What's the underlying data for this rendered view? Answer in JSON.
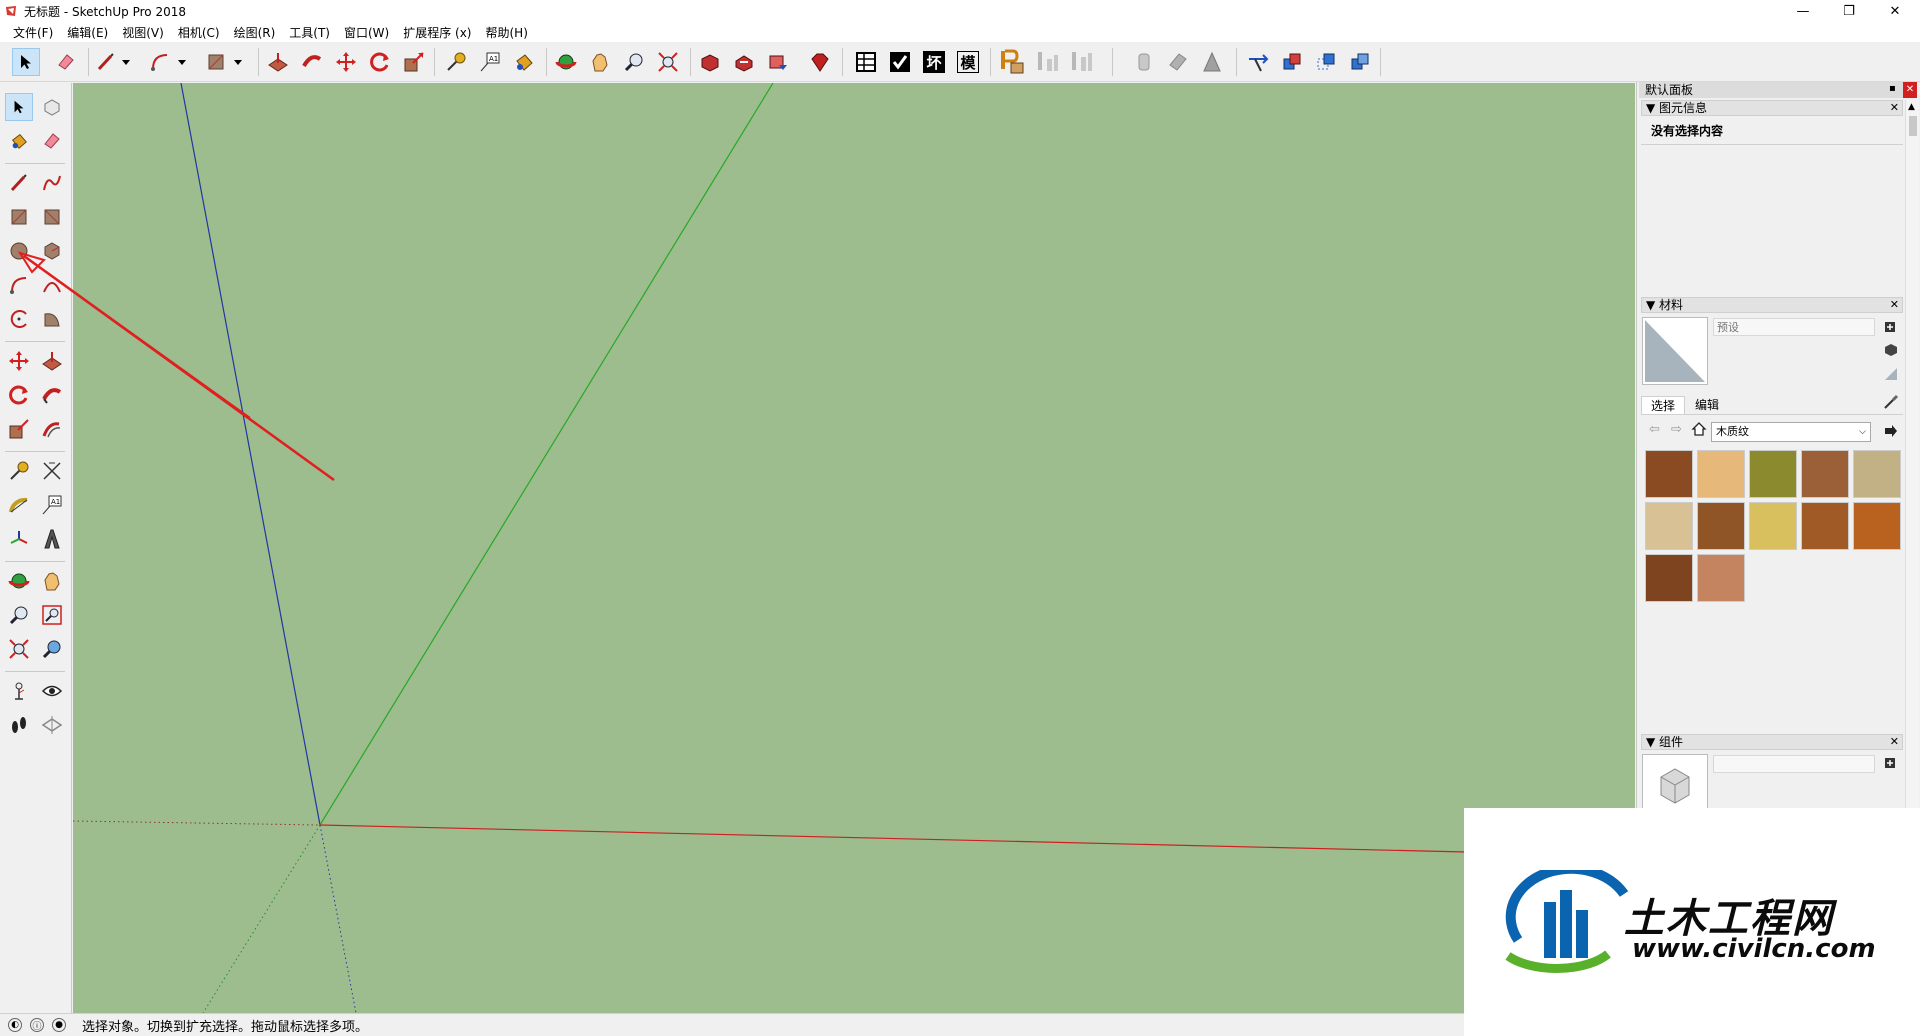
{
  "window": {
    "title": "无标题 - SketchUp Pro 2018",
    "controls": {
      "minimize": "—",
      "restore": "❐",
      "close": "✕"
    }
  },
  "menu": [
    "文件(F)",
    "编辑(E)",
    "视图(V)",
    "相机(C)",
    "绘图(R)",
    "工具(T)",
    "窗口(W)",
    "扩展程序 (x)",
    "帮助(H)"
  ],
  "toolbar": {
    "text_buttons": [
      "坏",
      "模"
    ]
  },
  "tray": {
    "title": "默认面板",
    "entity_info": {
      "header": "▼ 图元信息",
      "content": "没有选择内容"
    },
    "materials": {
      "header": "▼ 材料",
      "name_placeholder": "预设",
      "tabs": [
        "选择",
        "编辑"
      ],
      "library": "木质纹",
      "swatches": [
        "#8a4a22",
        "#e6b97a",
        "#8c8a2e",
        "#9b6038",
        "#c2b185",
        "#d9c196",
        "#8f5527",
        "#d8c05f",
        "#a05a26",
        "#b9621f",
        "#7e4420",
        "#c48460"
      ]
    },
    "components": {
      "header": "▼ 组件"
    }
  },
  "status": {
    "text": "选择对象。切换到扩充选择。拖动鼠标选择多项。"
  },
  "watermark": {
    "name": "土木工程网",
    "url": "www.civilcn.com"
  },
  "colors": {
    "viewport": "#9dbd8e",
    "axis_red": "#cc1f1f",
    "axis_green": "#27a827",
    "axis_blue": "#2336a3",
    "arrow": "#e02020"
  }
}
